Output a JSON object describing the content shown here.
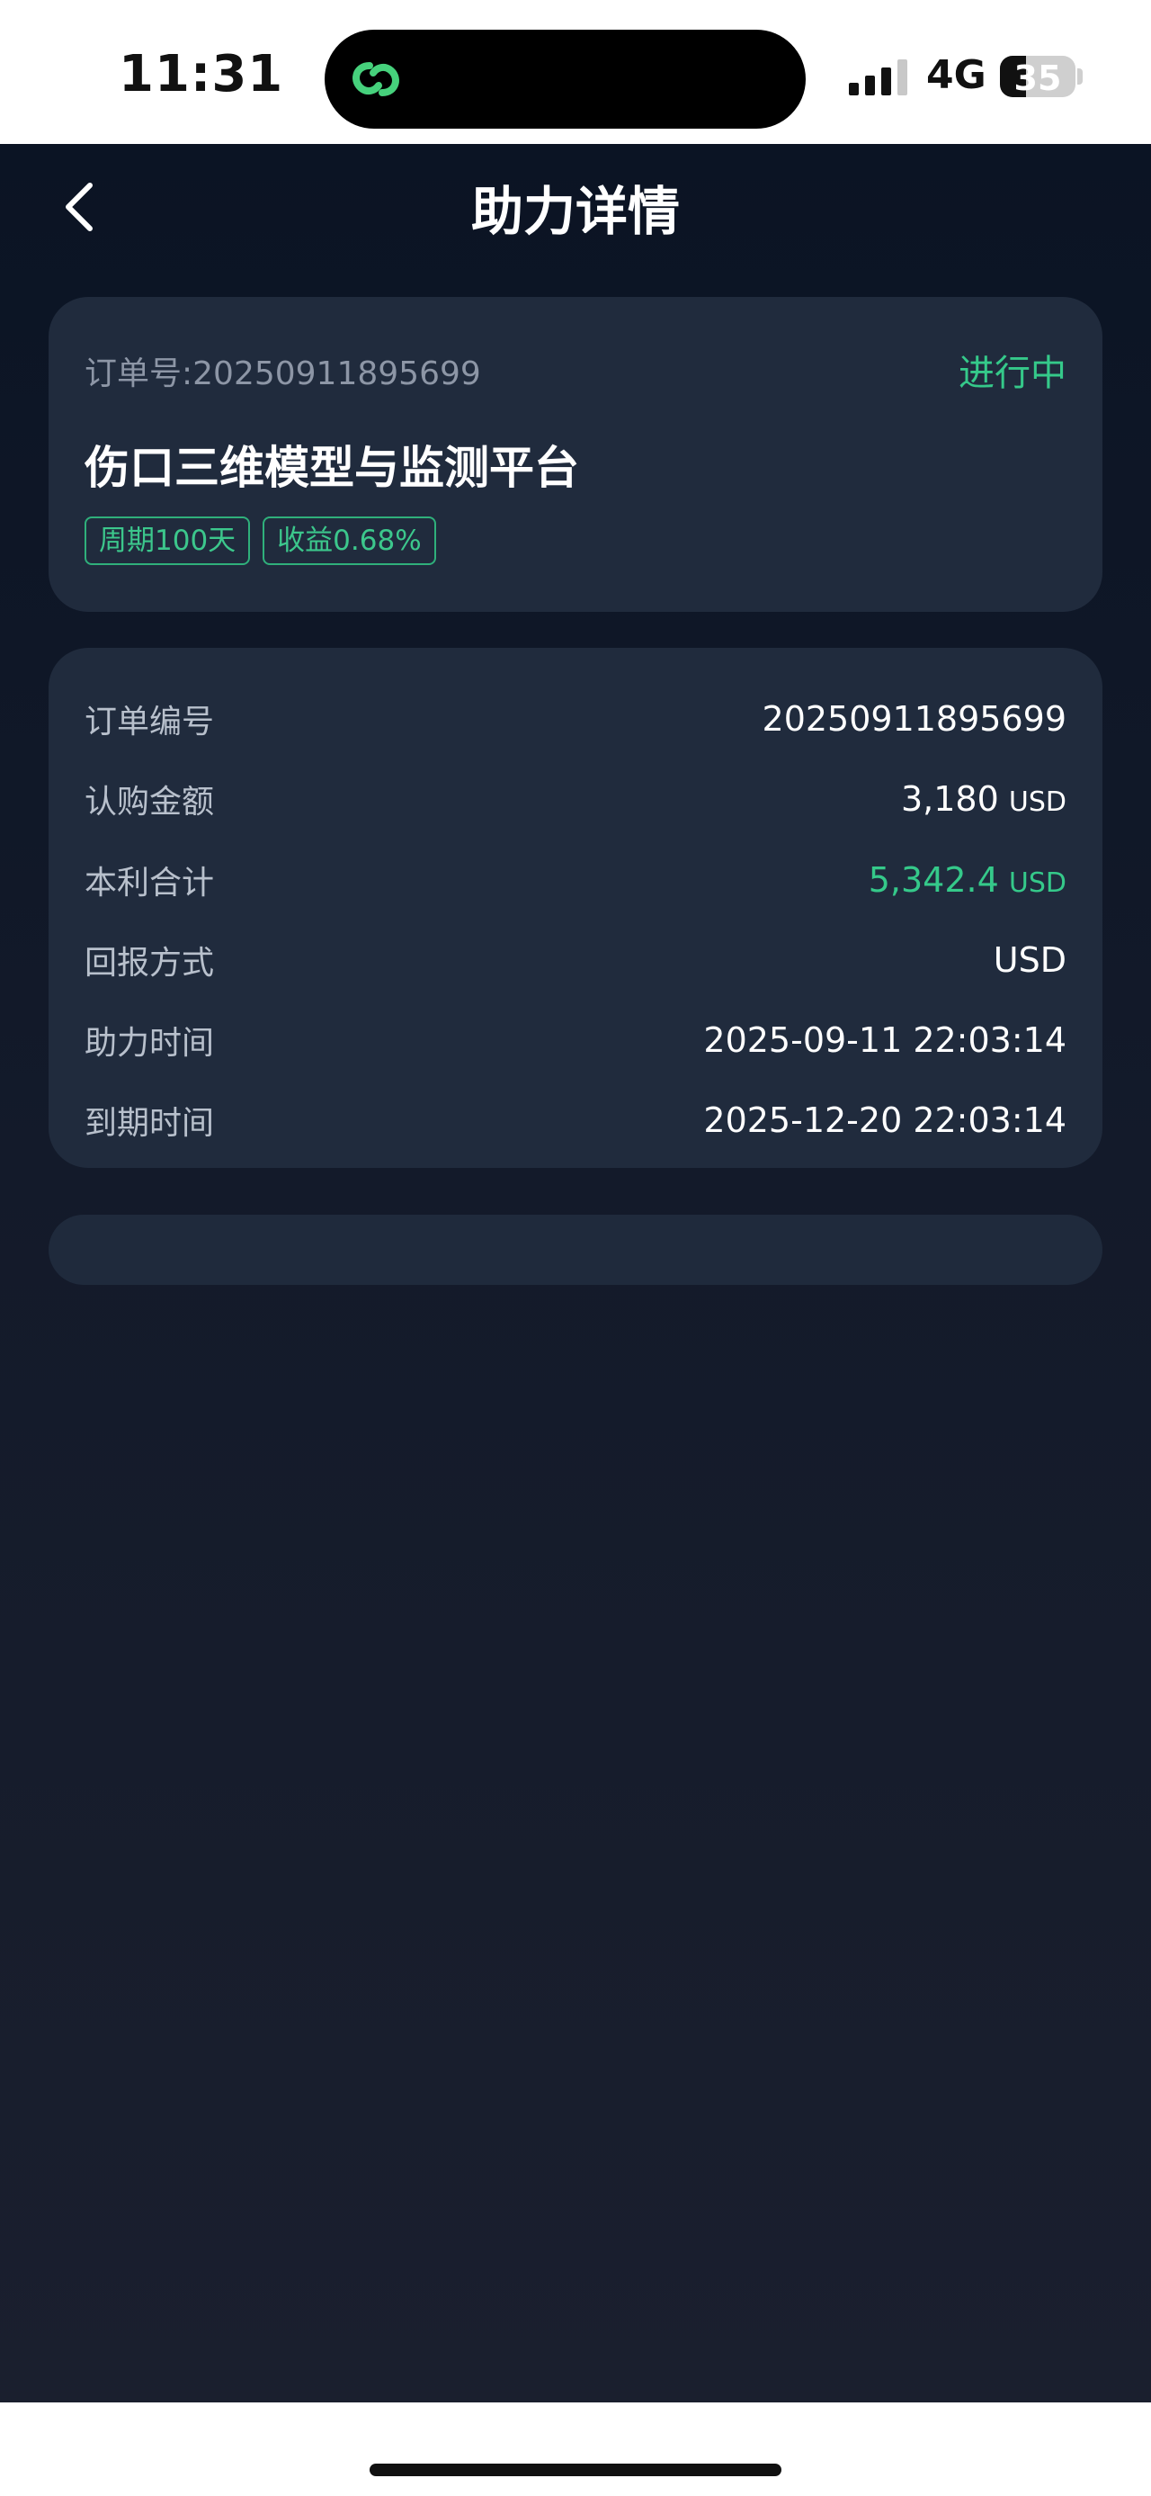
{
  "status_bar": {
    "time": "11:31",
    "network": "4G",
    "battery": "35",
    "battery_level": 0.35
  },
  "header": {
    "title": "助力详情"
  },
  "summary": {
    "order_no": "订单号:20250911895699",
    "status": "进行中",
    "project_name": "伤口三维模型与监测平台",
    "tags": [
      "周期100天",
      "收益0.68%"
    ]
  },
  "details": {
    "rows": [
      {
        "label": "订单编号",
        "value": "20250911895699",
        "unit": ""
      },
      {
        "label": "认购金额",
        "value": "3,180",
        "unit": "USD"
      },
      {
        "label": "本利合计",
        "value": "5,342.4",
        "unit": "USD"
      },
      {
        "label": "回报方式",
        "value": "USD",
        "unit": ""
      },
      {
        "label": "助力时间",
        "value": "2025-09-11 22:03:14",
        "unit": ""
      },
      {
        "label": "到期时间",
        "value": "2025-12-20 22:03:14",
        "unit": ""
      }
    ]
  },
  "colors": {
    "accent_green": "#35c98a",
    "background": "#0b1424",
    "card": "#202b3d"
  }
}
